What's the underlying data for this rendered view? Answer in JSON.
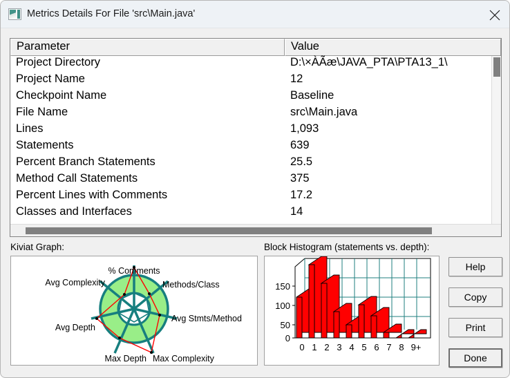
{
  "window": {
    "title": "Metrics Details For File 'src\\Main.java'",
    "icon": "metrics-window-icon",
    "close_icon": "close-icon"
  },
  "table": {
    "columns": [
      "Parameter",
      "Value"
    ],
    "rows": [
      {
        "parameter": "Project Directory",
        "value": "D:\\×ÀÃæ\\JAVA_PTA\\PTA13_1\\"
      },
      {
        "parameter": "Project Name",
        "value": "12"
      },
      {
        "parameter": "Checkpoint Name",
        "value": "Baseline"
      },
      {
        "parameter": "File Name",
        "value": "src\\Main.java"
      },
      {
        "parameter": "Lines",
        "value": "1,093"
      },
      {
        "parameter": "Statements",
        "value": "639"
      },
      {
        "parameter": "Percent Branch Statements",
        "value": "25.5"
      },
      {
        "parameter": "Method Call Statements",
        "value": "375"
      },
      {
        "parameter": "Percent Lines with Comments",
        "value": "17.2"
      },
      {
        "parameter": "Classes and Interfaces",
        "value": "14"
      }
    ]
  },
  "panels": {
    "kiviat_label": "Kiviat Graph:",
    "histogram_label": "Block Histogram (statements vs. depth):"
  },
  "buttons": {
    "help": "Help",
    "copy": "Copy",
    "print": "Print",
    "done": "Done"
  },
  "colors": {
    "kiviat_band": "#99ee88",
    "kiviat_spoke": "#177f7f",
    "kiviat_data": "#ff0000",
    "histogram_bar": "#ff0000",
    "histogram_bar_side": "#cc0000",
    "histogram_grid": "#1f7f7f",
    "titlebar": "#eef2f6"
  },
  "chart_data": [
    {
      "type": "radar",
      "title": "Kiviat Graph",
      "categories": [
        "% Comments",
        "Methods/Class",
        "Avg Stmts/Method",
        "Max Complexity",
        "Max Depth",
        "Avg Depth",
        "Avg Complexity"
      ],
      "values": [
        0.95,
        0.55,
        0.82,
        1.18,
        0.72,
        0.88,
        0.26
      ],
      "band_inner": 0.45,
      "band_outer": 0.95,
      "grid": true,
      "legend": "none"
    },
    {
      "type": "bar",
      "title": "Block Histogram (statements vs. depth)",
      "categories": [
        "0",
        "1",
        "2",
        "3",
        "4",
        "5",
        "6",
        "7",
        "8",
        "9+"
      ],
      "values": [
        105,
        190,
        141,
        68,
        34,
        86,
        58,
        13,
        1,
        1
      ],
      "xlabel": "depth",
      "ylabel": "statements",
      "yticks": [
        0,
        50,
        100,
        150
      ],
      "ylim": [
        0,
        200
      ],
      "grid": true,
      "legend": "none"
    }
  ]
}
